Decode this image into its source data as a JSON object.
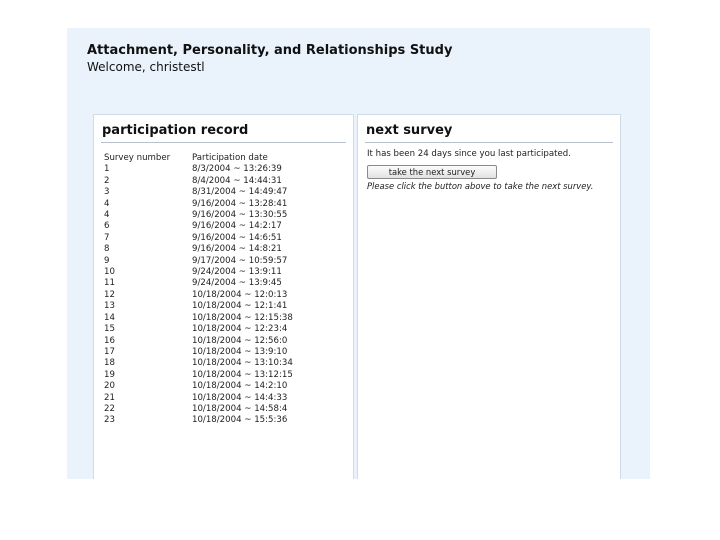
{
  "header": {
    "title": "Attachment, Personality, and Relationships Study",
    "welcome": "Welcome, christestl"
  },
  "participation": {
    "heading": "participation record",
    "columns": [
      "Survey number",
      "Participation date"
    ],
    "rows": [
      [
        "1",
        "8/3/2004 ~ 13:26:39"
      ],
      [
        "2",
        "8/4/2004 ~ 14:44:31"
      ],
      [
        "3",
        "8/31/2004 ~ 14:49:47"
      ],
      [
        "4",
        "9/16/2004 ~ 13:28:41"
      ],
      [
        "4",
        "9/16/2004 ~ 13:30:55"
      ],
      [
        "6",
        "9/16/2004 ~ 14:2:17"
      ],
      [
        "7",
        "9/16/2004 ~ 14:6:51"
      ],
      [
        "8",
        "9/16/2004 ~ 14:8:21"
      ],
      [
        "9",
        "9/17/2004 ~ 10:59:57"
      ],
      [
        "10",
        "9/24/2004 ~ 13:9:11"
      ],
      [
        "11",
        "9/24/2004 ~ 13:9:45"
      ],
      [
        "12",
        "10/18/2004 ~ 12:0:13"
      ],
      [
        "13",
        "10/18/2004 ~ 12:1:41"
      ],
      [
        "14",
        "10/18/2004 ~ 12:15:38"
      ],
      [
        "15",
        "10/18/2004 ~ 12:23:4"
      ],
      [
        "16",
        "10/18/2004 ~ 12:56:0"
      ],
      [
        "17",
        "10/18/2004 ~ 13:9:10"
      ],
      [
        "18",
        "10/18/2004 ~ 13:10:34"
      ],
      [
        "19",
        "10/18/2004 ~ 13:12:15"
      ],
      [
        "20",
        "10/18/2004 ~ 14:2:10"
      ],
      [
        "21",
        "10/18/2004 ~ 14:4:33"
      ],
      [
        "22",
        "10/18/2004 ~ 14:58:4"
      ],
      [
        "23",
        "10/18/2004 ~ 15:5:36"
      ]
    ]
  },
  "next_survey": {
    "heading": "next survey",
    "message": "It has been 24 days since you last participated.",
    "button_label": "take the next survey",
    "hint": "Please click the button above to take the next survey."
  }
}
